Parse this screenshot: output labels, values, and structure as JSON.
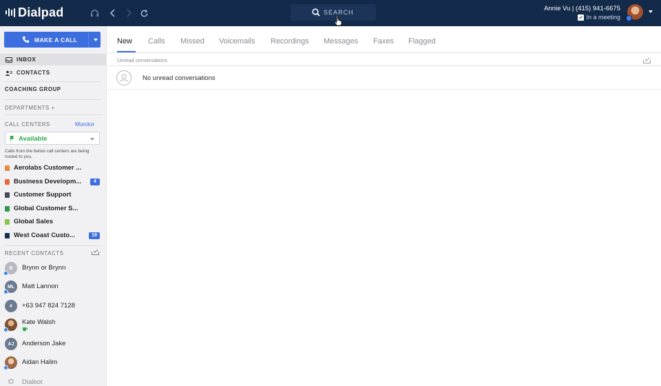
{
  "app": {
    "logo_text": "Dialpad",
    "search_label": "SEARCH",
    "user_name_line": "Annie Vu | (415) 941-6675",
    "user_status": "In a meeting"
  },
  "colors": {
    "topbar": "#132a4a",
    "accent": "#3d6ee0",
    "available": "#2eaa4c"
  },
  "sidebar": {
    "make_call_label": "MAKE A CALL",
    "inbox_label": "INBOX",
    "contacts_label": "CONTACTS",
    "coaching_group_label": "COACHING GROUP",
    "departments_label": "DEPARTMENTS +",
    "call_centers_label": "CALL CENTERS",
    "monitor_label": "Monitor",
    "availability": "Available",
    "routed_note": "Calls from the below call centers are being routed to you.",
    "call_centers": [
      {
        "label": "Aerolabs Customer ...",
        "color": "#e08a3c",
        "badge": ""
      },
      {
        "label": "Business Developm...",
        "color": "#e8663a",
        "badge": "4"
      },
      {
        "label": "Customer Support",
        "color": "#4a4a58",
        "badge": ""
      },
      {
        "label": "Global Customer S...",
        "color": "#2e9a48",
        "badge": ""
      },
      {
        "label": "Global Sales",
        "color": "#8bc34a",
        "badge": ""
      },
      {
        "label": "West Coast Custo...",
        "color": "#1a2d55",
        "badge": "19"
      }
    ],
    "recent_contacts_label": "RECENT CONTACTS",
    "recent_contacts": [
      {
        "name": "Brynn or Brynn",
        "initials": "B",
        "avatar_color": "#b8b8c0",
        "online": true
      },
      {
        "name": "Matt Lannon",
        "initials": "ML",
        "avatar_color": "#6b7a90",
        "online": true
      },
      {
        "name": "+63 947 824 7128",
        "initials": "#",
        "avatar_color": "#6b7a90",
        "online": false
      },
      {
        "name": "Kate Walsh",
        "initials": "",
        "avatar_color": "#8a6a4a",
        "online": true
      },
      {
        "name": "Anderson Jake",
        "initials": "AJ",
        "avatar_color": "#6b7a90",
        "online": false
      },
      {
        "name": "Aidan Halim",
        "initials": "",
        "avatar_color": "#c89070",
        "online": true
      },
      {
        "name": "Dialbot",
        "initials": "",
        "avatar_color": "#f1f1f3",
        "online": false
      }
    ]
  },
  "main": {
    "tabs": [
      "New",
      "Calls",
      "Missed",
      "Voicemails",
      "Recordings",
      "Messages",
      "Faxes",
      "Flagged"
    ],
    "active_tab": "New",
    "unread_label": "Unread conversations",
    "empty_label": "No unread conversations"
  }
}
